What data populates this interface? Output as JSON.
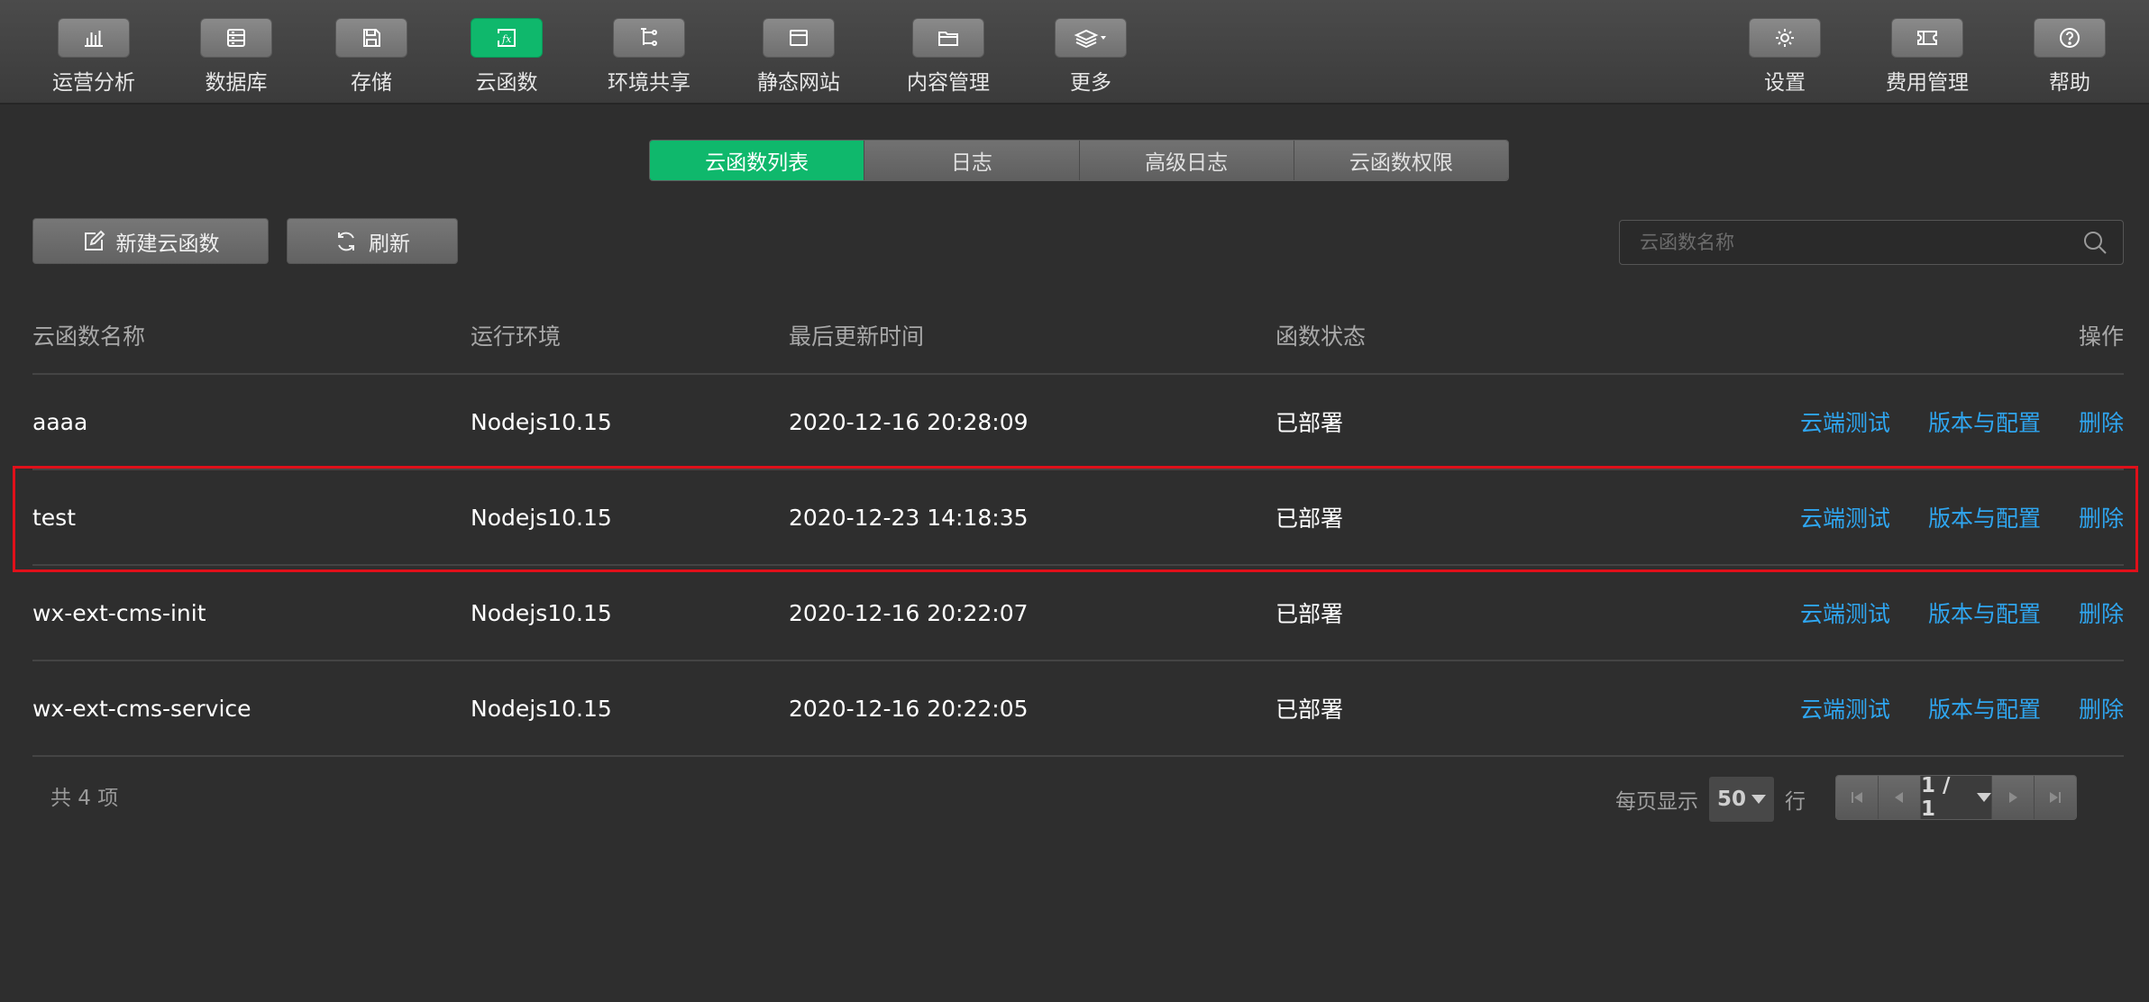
{
  "toolbar": {
    "items": [
      {
        "label": "运营分析",
        "icon": "bar-chart-icon"
      },
      {
        "label": "数据库",
        "icon": "database-icon"
      },
      {
        "label": "存储",
        "icon": "save-icon"
      },
      {
        "label": "云函数",
        "icon": "function-icon",
        "active": true
      },
      {
        "label": "环境共享",
        "icon": "share-tree-icon"
      },
      {
        "label": "静态网站",
        "icon": "browser-window-icon"
      },
      {
        "label": "内容管理",
        "icon": "folder-icon"
      },
      {
        "label": "更多",
        "icon": "layers-icon"
      }
    ],
    "right_items": [
      {
        "label": "设置",
        "icon": "gear-icon"
      },
      {
        "label": "费用管理",
        "icon": "ticket-icon"
      },
      {
        "label": "帮助",
        "icon": "help-icon"
      }
    ]
  },
  "tabs": [
    "云函数列表",
    "日志",
    "高级日志",
    "云函数权限"
  ],
  "active_tab": "云函数列表",
  "actions": {
    "new_label": "新建云函数",
    "refresh_label": "刷新"
  },
  "search": {
    "placeholder": "云函数名称",
    "value": ""
  },
  "table": {
    "columns": [
      "云函数名称",
      "运行环境",
      "最后更新时间",
      "函数状态",
      "操作"
    ],
    "rows": [
      {
        "name": "aaaa",
        "env": "Nodejs10.15",
        "time": "2020-12-16 20:28:09",
        "status": "已部署"
      },
      {
        "name": "test",
        "env": "Nodejs10.15",
        "time": "2020-12-23 14:18:35",
        "status": "已部署",
        "highlighted": true
      },
      {
        "name": "wx-ext-cms-init",
        "env": "Nodejs10.15",
        "time": "2020-12-16 20:22:07",
        "status": "已部署"
      },
      {
        "name": "wx-ext-cms-service",
        "env": "Nodejs10.15",
        "time": "2020-12-16 20:22:05",
        "status": "已部署"
      }
    ],
    "row_actions": [
      "云端测试",
      "版本与配置",
      "删除"
    ]
  },
  "footer": {
    "total_text": "共 4 项",
    "per_page_prefix": "每页显示",
    "per_page_value": "50",
    "per_page_suffix": "行",
    "page_indicator": "1 / 1"
  },
  "colors": {
    "accent": "#0fb86c",
    "link": "#2fa6f0",
    "highlight_border": "#e0101a",
    "background": "#2e2e2e"
  }
}
